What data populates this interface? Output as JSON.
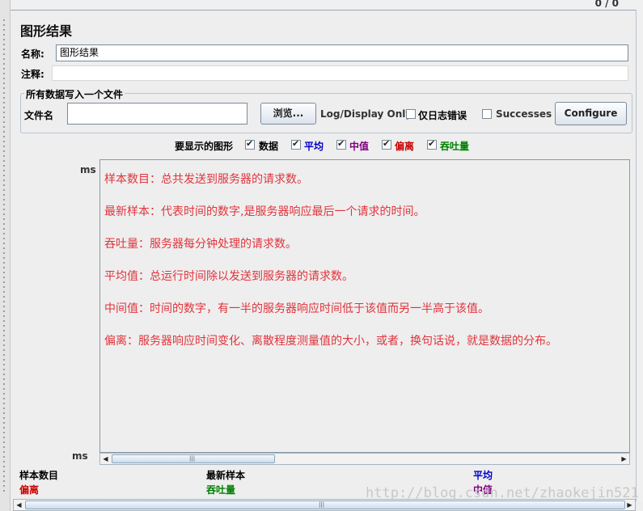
{
  "top": {
    "counter": "0 / 0"
  },
  "panel": {
    "title": "图形结果",
    "name_label": "名称:",
    "name_value": "图形结果",
    "comment_label": "注释:",
    "comment_value": ""
  },
  "file_group": {
    "legend": "所有数据写入一个文件",
    "file_label": "文件名",
    "file_value": "",
    "browse_button": "浏览...",
    "log_display_label": "Log/Display Only:",
    "errors_only_label": "仅日志错误",
    "errors_only_checked": false,
    "successes_label": "Successes",
    "successes_checked": false,
    "configure_button": "Configure"
  },
  "graphs": {
    "label": "要显示的图形",
    "options": [
      {
        "label": "数据",
        "checked": true,
        "color": "#000000"
      },
      {
        "label": "平均",
        "checked": true,
        "color": "#0000cc"
      },
      {
        "label": "中值",
        "checked": true,
        "color": "#800080"
      },
      {
        "label": "偏离",
        "checked": true,
        "color": "#cc0000"
      },
      {
        "label": "吞吐量",
        "checked": true,
        "color": "#008000"
      }
    ]
  },
  "axis": {
    "unit_top": "ms",
    "unit_bottom": "ms"
  },
  "notes": [
    "样本数目：总共发送到服务器的请求数。",
    "最新样本：代表时间的数字,是服务器响应最后一个请求的时间。",
    "吞吐量：服务器每分钟处理的请求数。",
    "平均值：总运行时间除以发送到服务器的请求数。",
    "中间值：时间的数字，有一半的服务器响应时间低于该值而另一半高于该值。",
    "偏离：服务器响应时间变化、离散程度测量值的大小，或者，换句话说，就是数据的分布。"
  ],
  "legend": {
    "row1": [
      {
        "label": "样本数目",
        "color": "#000000"
      },
      {
        "label": "最新样本",
        "color": "#000000"
      },
      {
        "label": "平均",
        "color": "#0000cc"
      }
    ],
    "row2": [
      {
        "label": "偏离",
        "color": "#cc0000"
      },
      {
        "label": "吞吐量",
        "color": "#008000"
      },
      {
        "label": "中值",
        "color": "#800080"
      }
    ]
  },
  "watermark": "http://blog.csdn.net/zhaokejin521",
  "colors": {
    "note_text": "#e0343c",
    "background": "#eeeeee",
    "border": "#8a98a6"
  }
}
